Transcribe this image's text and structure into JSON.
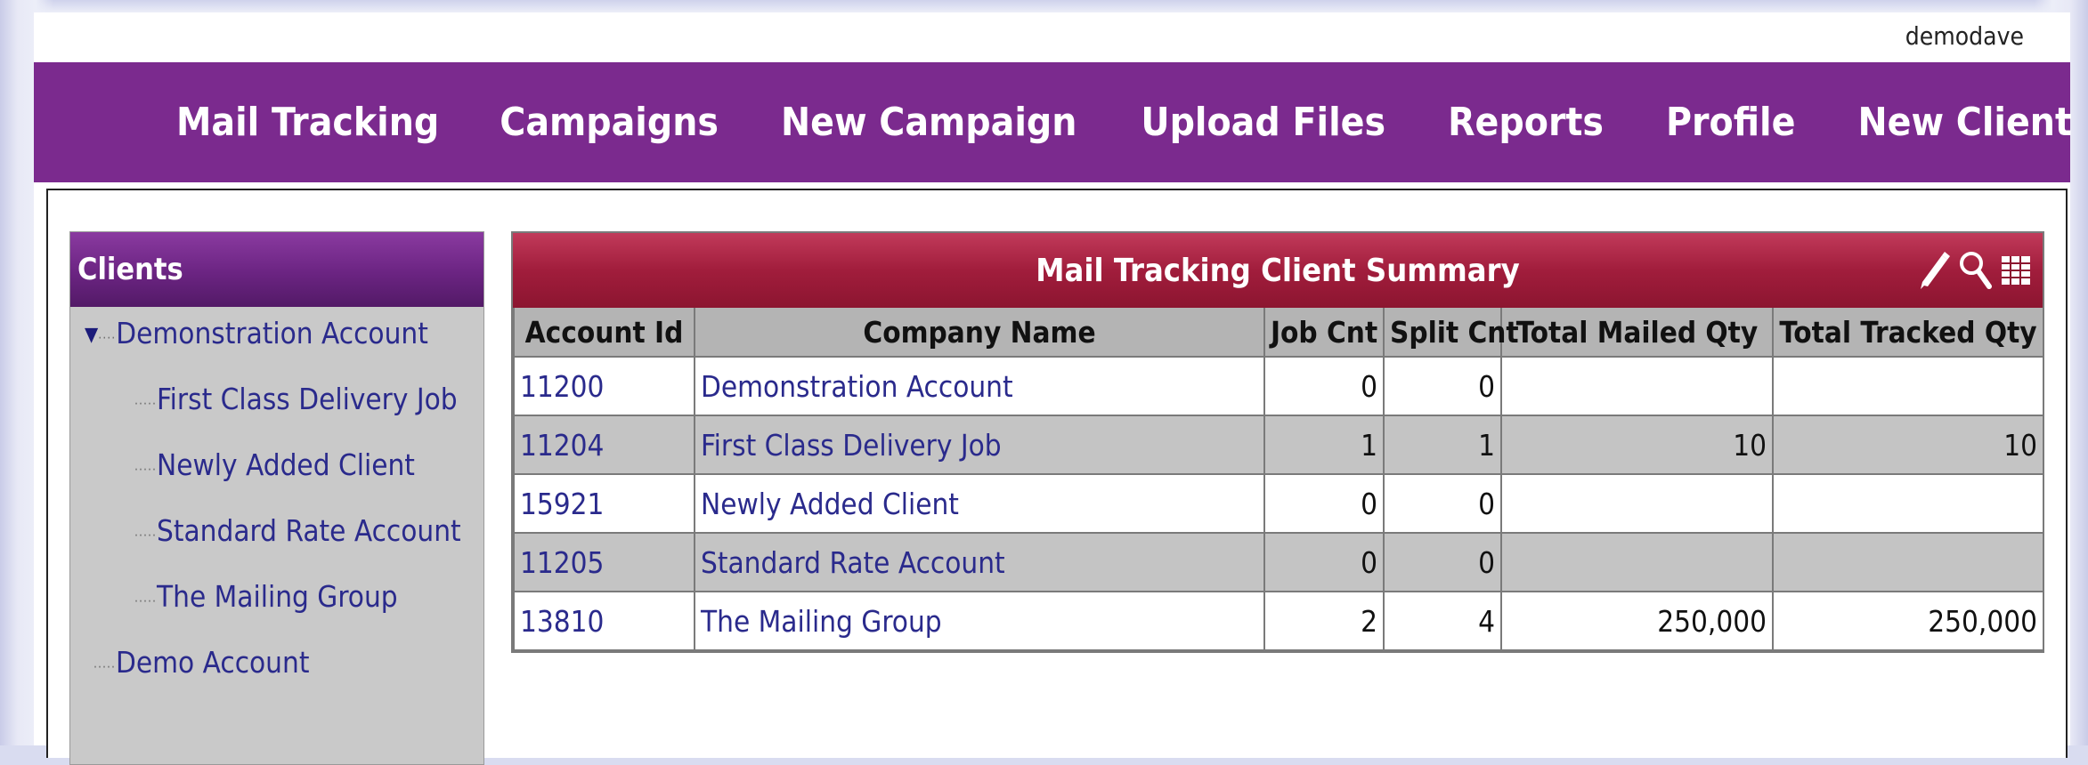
{
  "header": {
    "username": "demodave"
  },
  "nav": {
    "items": [
      {
        "label": "Mail Tracking",
        "name": "nav-mail-tracking"
      },
      {
        "label": "Campaigns",
        "name": "nav-campaigns"
      },
      {
        "label": "New Campaign",
        "name": "nav-new-campaign"
      },
      {
        "label": "Upload Files",
        "name": "nav-upload-files"
      },
      {
        "label": "Reports",
        "name": "nav-reports"
      },
      {
        "label": "Profile",
        "name": "nav-profile"
      },
      {
        "label": "New Client",
        "name": "nav-new-client"
      }
    ]
  },
  "sidebar": {
    "title": "Clients",
    "tree": [
      {
        "label": "Demonstration Account",
        "level": 0,
        "expanded": true
      },
      {
        "label": "First Class Delivery Job",
        "level": 1
      },
      {
        "label": "Newly Added Client",
        "level": 1
      },
      {
        "label": "Standard Rate Account",
        "level": 1
      },
      {
        "label": "The Mailing Group",
        "level": 1
      },
      {
        "label": "Demo Account",
        "level": 0,
        "expanded": false
      }
    ]
  },
  "grid": {
    "title": "Mail Tracking Client Summary",
    "tools": [
      "pencil-icon",
      "search-icon",
      "table-icon"
    ],
    "columns": [
      "Account Id",
      "Company Name",
      "Job Cnt",
      "Split Cnt",
      "Total Mailed Qty",
      "Total Tracked Qty"
    ],
    "rows": [
      {
        "account_id": "11200",
        "company": "Demonstration Account",
        "job_cnt": "0",
        "split_cnt": "0",
        "mailed": "",
        "tracked": ""
      },
      {
        "account_id": "11204",
        "company": "First Class Delivery Job",
        "job_cnt": "1",
        "split_cnt": "1",
        "mailed": "10",
        "tracked": "10"
      },
      {
        "account_id": "15921",
        "company": "Newly Added Client",
        "job_cnt": "0",
        "split_cnt": "0",
        "mailed": "",
        "tracked": ""
      },
      {
        "account_id": "11205",
        "company": "Standard Rate Account",
        "job_cnt": "0",
        "split_cnt": "0",
        "mailed": "",
        "tracked": ""
      },
      {
        "account_id": "13810",
        "company": "The Mailing Group",
        "job_cnt": "2",
        "split_cnt": "4",
        "mailed": "250,000",
        "tracked": "250,000"
      }
    ]
  },
  "colors": {
    "nav_bg": "#7b2a8e",
    "grid_header": "#a11d3c",
    "link": "#2a2a8c",
    "row_alt": "#c4c4c4"
  }
}
